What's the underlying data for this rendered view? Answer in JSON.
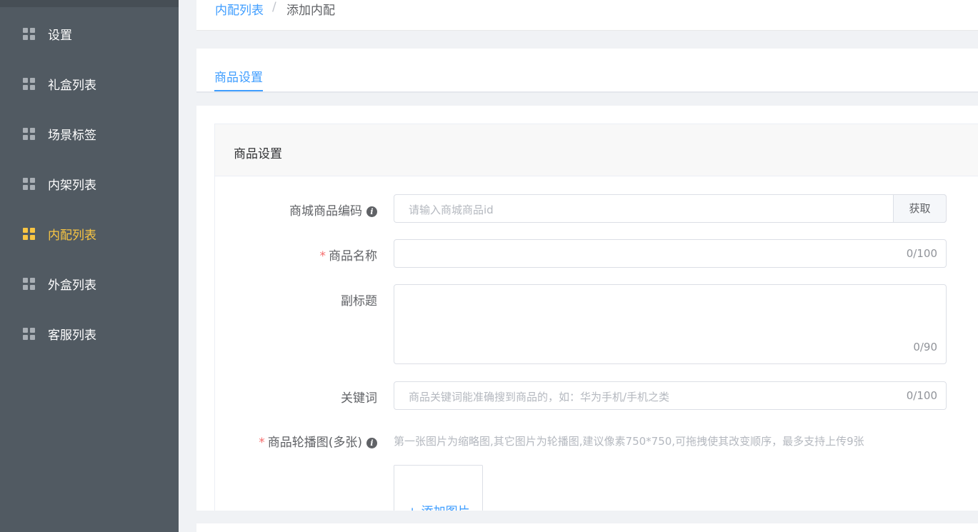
{
  "sidebar": {
    "items": [
      {
        "label": "设置",
        "icon": "grid-icon",
        "active": false
      },
      {
        "label": "礼盒列表",
        "icon": "grid-icon",
        "active": false
      },
      {
        "label": "场景标签",
        "icon": "grid-icon",
        "active": false
      },
      {
        "label": "内架列表",
        "icon": "grid-icon",
        "active": false
      },
      {
        "label": "内配列表",
        "icon": "grid-icon",
        "active": true
      },
      {
        "label": "外盒列表",
        "icon": "grid-icon",
        "active": false
      },
      {
        "label": "客服列表",
        "icon": "grid-icon",
        "active": false
      }
    ],
    "active_color": "#f8c543"
  },
  "breadcrumb": {
    "parent": "内配列表",
    "separator": "/",
    "current": "添加内配"
  },
  "tabs": [
    {
      "label": "商品设置",
      "active": true
    }
  ],
  "card": {
    "title": "商品设置"
  },
  "form": {
    "product_code": {
      "label": "商城商品编码",
      "placeholder": "请输入商城商品id",
      "button_label": "获取",
      "info_icon": "i"
    },
    "product_name": {
      "required_mark": "*",
      "label": "商品名称",
      "count": "0/100"
    },
    "subtitle": {
      "label": "副标题",
      "count": "0/90"
    },
    "keywords": {
      "label": "关键词",
      "placeholder": "商品关键词能准确搜到商品的，如：华为手机/手机之类",
      "count": "0/100"
    },
    "carousel": {
      "required_mark": "*",
      "label": "商品轮播图(多张)",
      "info_icon": "i",
      "hint": "第一张图片为缩略图,其它图片为轮播图,建议像素750*750,可拖拽使其改变顺序，最多支持上传9张",
      "upload_label": "+ 添加图片"
    }
  },
  "colors": {
    "sidebar_bg": "#515a62",
    "accent": "#409eff",
    "required": "#f56c6c"
  }
}
